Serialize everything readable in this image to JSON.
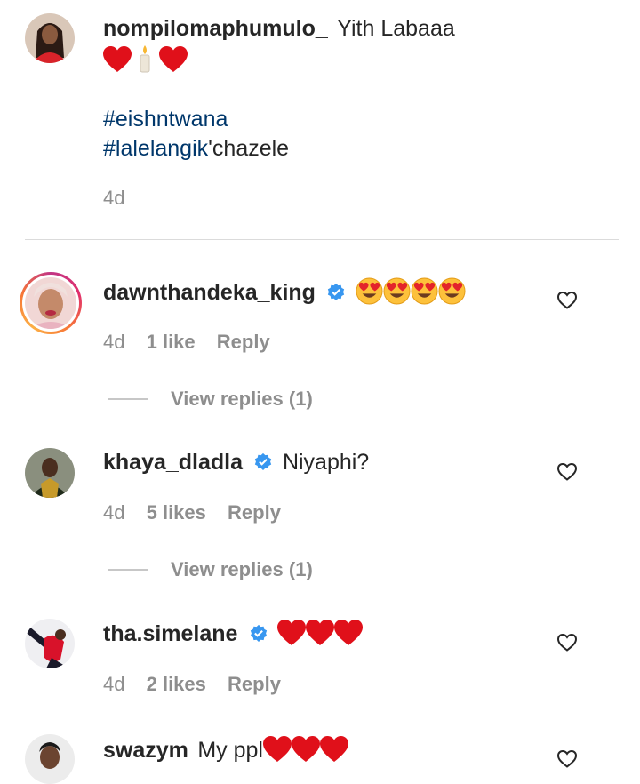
{
  "comments": [
    {
      "username": "nompilomaphumulo_",
      "text": "Yith Labaaa",
      "emoji_line": [
        "red-heart",
        "candle",
        "red-heart"
      ],
      "hashtag1": "#eishntwana",
      "hashtag2": "#lalelangik",
      "hashtag2_suffix": "'chazele",
      "time": "4d"
    },
    {
      "username": "dawnthandeka_king",
      "verified": true,
      "emojis": [
        "heart-eyes",
        "heart-eyes",
        "heart-eyes",
        "heart-eyes"
      ],
      "time": "4d",
      "likes": "1 like",
      "reply_label": "Reply",
      "view_replies": "View replies (1)"
    },
    {
      "username": "khaya_dladla",
      "verified": true,
      "text": "Niyaphi?",
      "time": "4d",
      "likes": "5 likes",
      "reply_label": "Reply",
      "view_replies": "View replies (1)"
    },
    {
      "username": "tha.simelane",
      "verified": true,
      "emojis": [
        "red-heart",
        "red-heart",
        "red-heart"
      ],
      "time": "4d",
      "likes": "2 likes",
      "reply_label": "Reply"
    },
    {
      "username": "swazym",
      "text": "My ppl",
      "emojis": [
        "red-heart",
        "red-heart",
        "red-heart"
      ]
    }
  ],
  "icons": {
    "like": "heart-outline-icon",
    "verified": "verified-badge-icon"
  },
  "colors": {
    "text": "#262626",
    "secondary": "#8e8e8e",
    "hashtag": "#00376b",
    "verified": "#3897f0",
    "divider": "#dbdbdb"
  }
}
